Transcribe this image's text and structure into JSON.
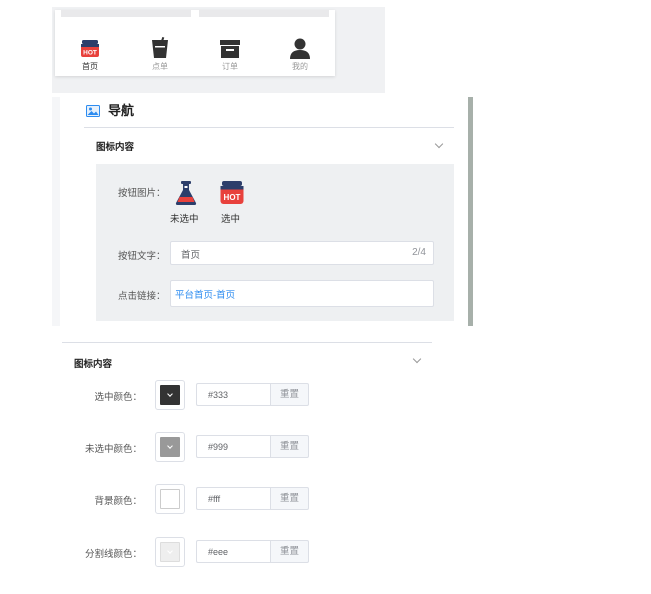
{
  "preview": {
    "tabs": [
      {
        "label": "首页",
        "icon": "hot-icon",
        "active": true
      },
      {
        "label": "点单",
        "icon": "cup-icon",
        "active": false
      },
      {
        "label": "订单",
        "icon": "archive-icon",
        "active": false
      },
      {
        "label": "我的",
        "icon": "user-icon",
        "active": false
      }
    ]
  },
  "nav_panel": {
    "title": "导航",
    "section_title": "图标内容",
    "button_image_label": "按钮图片：",
    "unselected_caption": "未选中",
    "selected_caption": "选中",
    "button_text_label": "按钮文字：",
    "button_text_value": "首页",
    "button_text_count": "2/4",
    "link_label": "点击链接：",
    "link_value": "平台首页-首页"
  },
  "color_section": {
    "title": "图标内容",
    "rows": [
      {
        "label": "选中颜色：",
        "hex": "#333",
        "swatch": "#333333",
        "reset": "重置"
      },
      {
        "label": "未选中颜色：",
        "hex": "#999",
        "swatch": "#999999",
        "reset": "重置"
      },
      {
        "label": "背景颜色：",
        "hex": "#fff",
        "swatch": "#ffffff",
        "reset": "重置"
      },
      {
        "label": "分割线颜色：",
        "hex": "#eee",
        "swatch": "#eeeeee",
        "reset": "重置"
      }
    ]
  },
  "colors": {
    "accent": "#2d8cf0",
    "hot_red": "#e8413c",
    "flask_navy": "#2c3e6b"
  }
}
